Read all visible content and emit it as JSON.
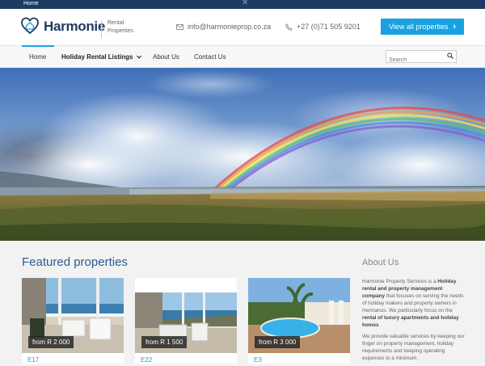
{
  "topbar": {
    "crumb": "Home",
    "close_glyph": "✕"
  },
  "brand": {
    "name": "Harmonie",
    "sub_line1": "Rental",
    "sub_line2": "Properties",
    "icon": "heart-house-icon"
  },
  "contact": {
    "email": "info@harmonieprop.co.za",
    "phone": "+27 (0)71 505 9201"
  },
  "cta": {
    "label": "View all properties",
    "arrow": "›"
  },
  "nav": {
    "home": "Home",
    "holiday": "Holiday Rental Listings",
    "about": "About Us",
    "contact": "Contact Us",
    "search_placeholder": "Search"
  },
  "featured": {
    "title": "Featured properties",
    "cards": [
      {
        "price": "from R 2 000",
        "code": "E17"
      },
      {
        "price": "from R 1 500",
        "code": "E22"
      },
      {
        "price": "from R 3 000",
        "code": "E3"
      }
    ]
  },
  "about": {
    "title": "About Us",
    "p1_a": "Harmonie Property Services is a ",
    "p1_b": "Holiday rental and property management company",
    "p1_c": " that focuses on serving the needs of holiday makers and property owners in Hermanus. We particularly focus on the ",
    "p1_d": "rental of luxury apartments and holiday homes",
    "p2": "We provide valuable services by keeping our finger on property management, holiday requirements and keeping operating expenses to a minimum."
  },
  "colors": {
    "navy": "#1d3b63",
    "accent": "#1aa1e0"
  }
}
